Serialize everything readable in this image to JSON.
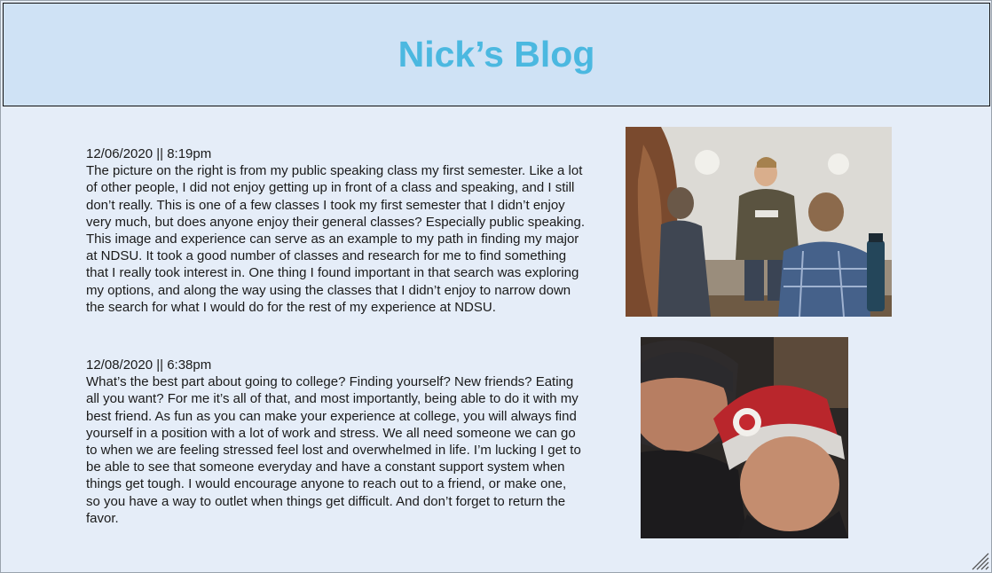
{
  "blog": {
    "title": "Nick’s Blog"
  },
  "posts": [
    {
      "timestamp": "12/06/2020 || 8:19pm",
      "body": "The picture on the right is from my public speaking class my first semester. Like a lot of other people, I did not enjoy getting up in front of a class and speaking, and I still don’t really. This is one of a few classes I took my first semester that I didn’t enjoy very much, but does anyone enjoy their general classes? Especially public speaking. This image and experience can serve as an example to my path in finding my major at NDSU. It took a good number of classes and research for me to find something that I really took interest in. One thing I found important in that search was exploring my options, and along the way using the classes that I didn’t enjoy to narrow down the search for what I would do for the rest of my experience at NDSU."
    },
    {
      "timestamp": "12/08/2020 || 6:38pm",
      "body": "What’s the best part about going to college? Finding yourself? New friends? Eating all you want? For me it’s all of that, and most importantly, being able to do it with my best friend. As fun as you can make your experience at college, you will always find yourself in a position with a lot of work and stress. We all need someone we can go to when we are feeling stressed feel lost and overwhelmed in life. I’m lucking I get to be able to see that someone everyday and have a constant support system when things get tough. I would encourage anyone to reach out to a friend, or make one, so you have a way to outlet when things get difficult. And don’t forget to return the favor."
    }
  ],
  "colors": {
    "page_background": "#e5edf8",
    "header_background": "#cfe2f5",
    "title_color": "#4bb8e0",
    "text_color": "#1a1a1a"
  },
  "icons": {
    "resize": "resize-grip-icon"
  }
}
